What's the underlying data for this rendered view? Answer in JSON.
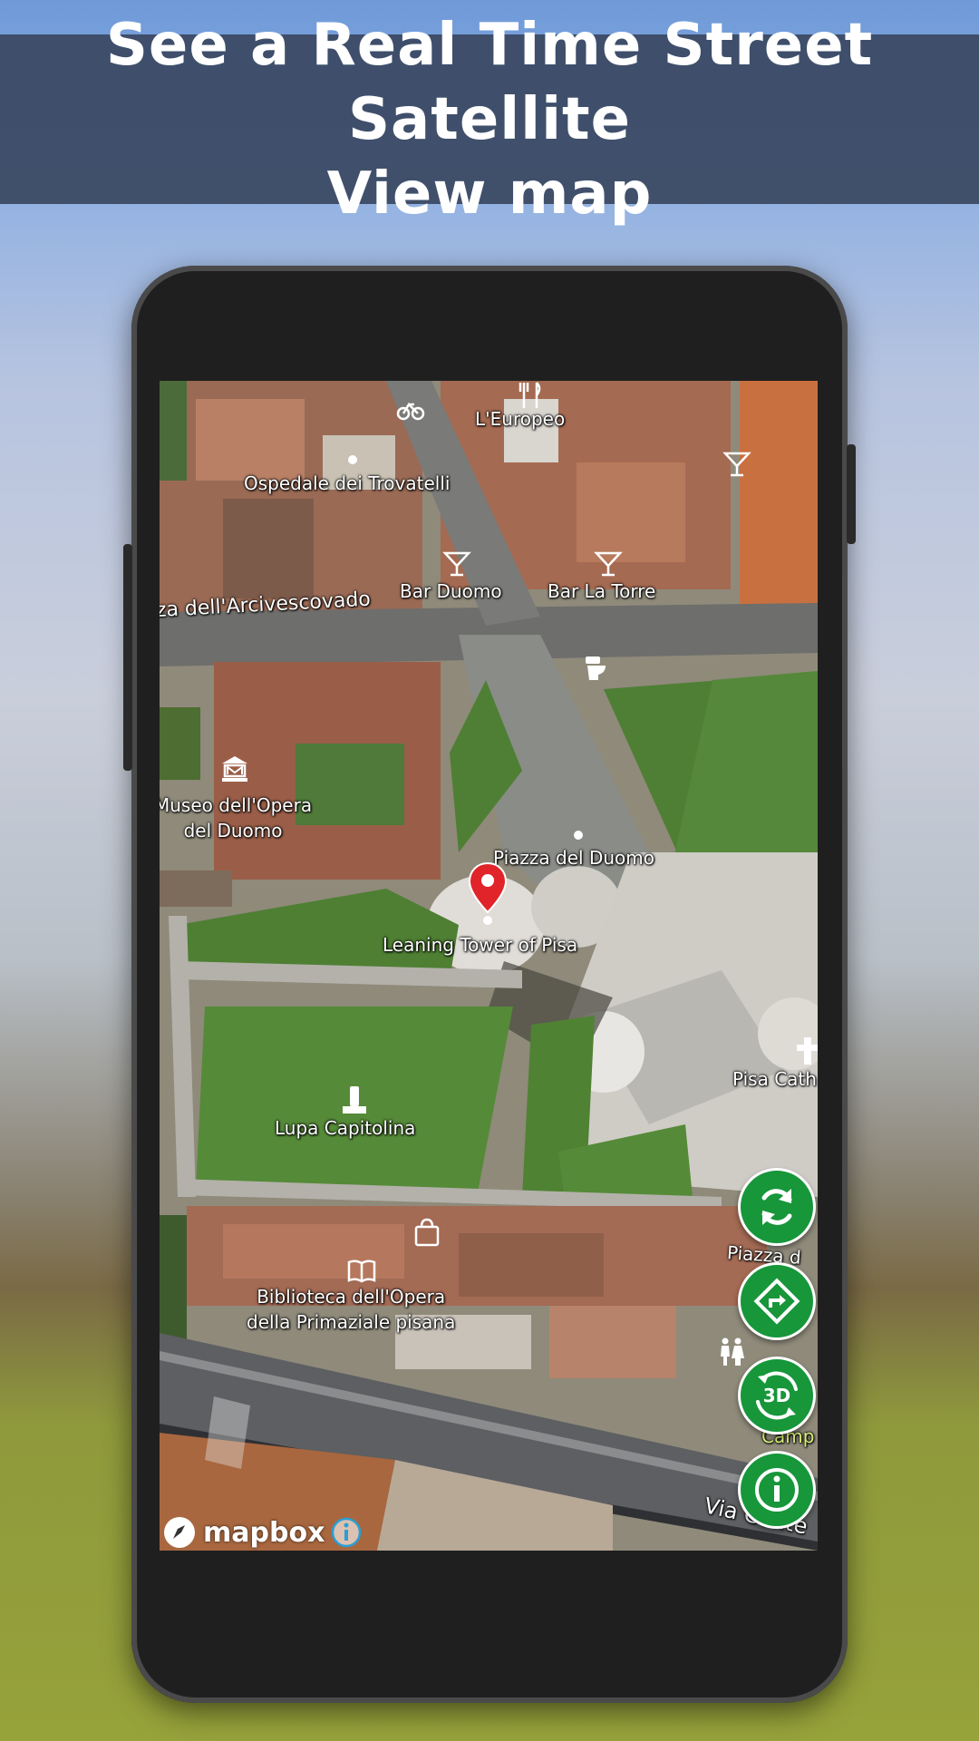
{
  "banner": {
    "title": "See a Real Time Street Satellite\nView map"
  },
  "map": {
    "labels": {
      "leuropeo": "L'Europeo",
      "ospedale": "Ospedale dei Trovatelli",
      "bar_duomo": "Bar Duomo",
      "bar_la_torre": "Bar La Torre",
      "arcivescovado": "za dell'Arcivescovado",
      "museo": "Museo dell'Opera\ndel Duomo",
      "piazza_duomo": "Piazza del Duomo",
      "leaning_tower": "Leaning Tower of Pisa",
      "pisa_cath": "Pisa Cath",
      "lupa": "Lupa Capitolina",
      "piazza_d": "Piazza d",
      "biblioteca": "Biblioteca dell'Opera\ndella Primaziale pisana",
      "camp": "Camp",
      "via_conte": "Via Conte"
    },
    "attribution": "mapbox"
  },
  "controls": {
    "refresh_icon": "refresh-icon",
    "directions_icon": "directions-icon",
    "view3d_label": "3D",
    "info_icon": "info-icon"
  },
  "colors": {
    "banner": "#3a4862",
    "fab": "#17963a",
    "pin": "#e0242a"
  }
}
